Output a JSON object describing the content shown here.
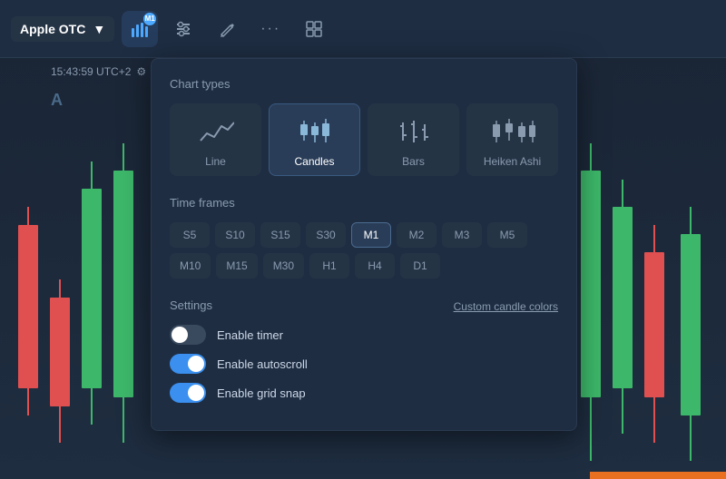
{
  "toolbar": {
    "asset_label": "Apple OTC",
    "asset_chevron": "▼",
    "badge_label": "M1",
    "btn_chart_title": "chart-type",
    "btn_settings_title": "settings",
    "btn_draw_title": "draw",
    "btn_more_title": "more",
    "btn_layout_title": "layout"
  },
  "sidebar": {
    "time_label": "15:43:59 UTC+2",
    "chart_letter": "A"
  },
  "panel": {
    "chart_types_title": "Chart types",
    "types": [
      {
        "id": "line",
        "label": "Line",
        "active": false
      },
      {
        "id": "candles",
        "label": "Candles",
        "active": true
      },
      {
        "id": "bars",
        "label": "Bars",
        "active": false
      },
      {
        "id": "heiken_ashi",
        "label": "Heiken Ashi",
        "active": false
      }
    ],
    "timeframes_title": "Time frames",
    "timeframes_row1": [
      "S5",
      "S10",
      "S15",
      "S30",
      "M1",
      "M2",
      "M3"
    ],
    "timeframes_row2": [
      "M5",
      "M10",
      "M15",
      "M30",
      "H1",
      "H4",
      "D1"
    ],
    "active_tf": "M1",
    "settings_title": "Settings",
    "custom_candle_label": "Custom candle colors",
    "settings": [
      {
        "id": "enable_timer",
        "label": "Enable timer",
        "on": false
      },
      {
        "id": "enable_autoscroll",
        "label": "Enable autoscroll",
        "on": true
      },
      {
        "id": "enable_grid_snap",
        "label": "Enable grid snap",
        "on": true
      }
    ]
  }
}
